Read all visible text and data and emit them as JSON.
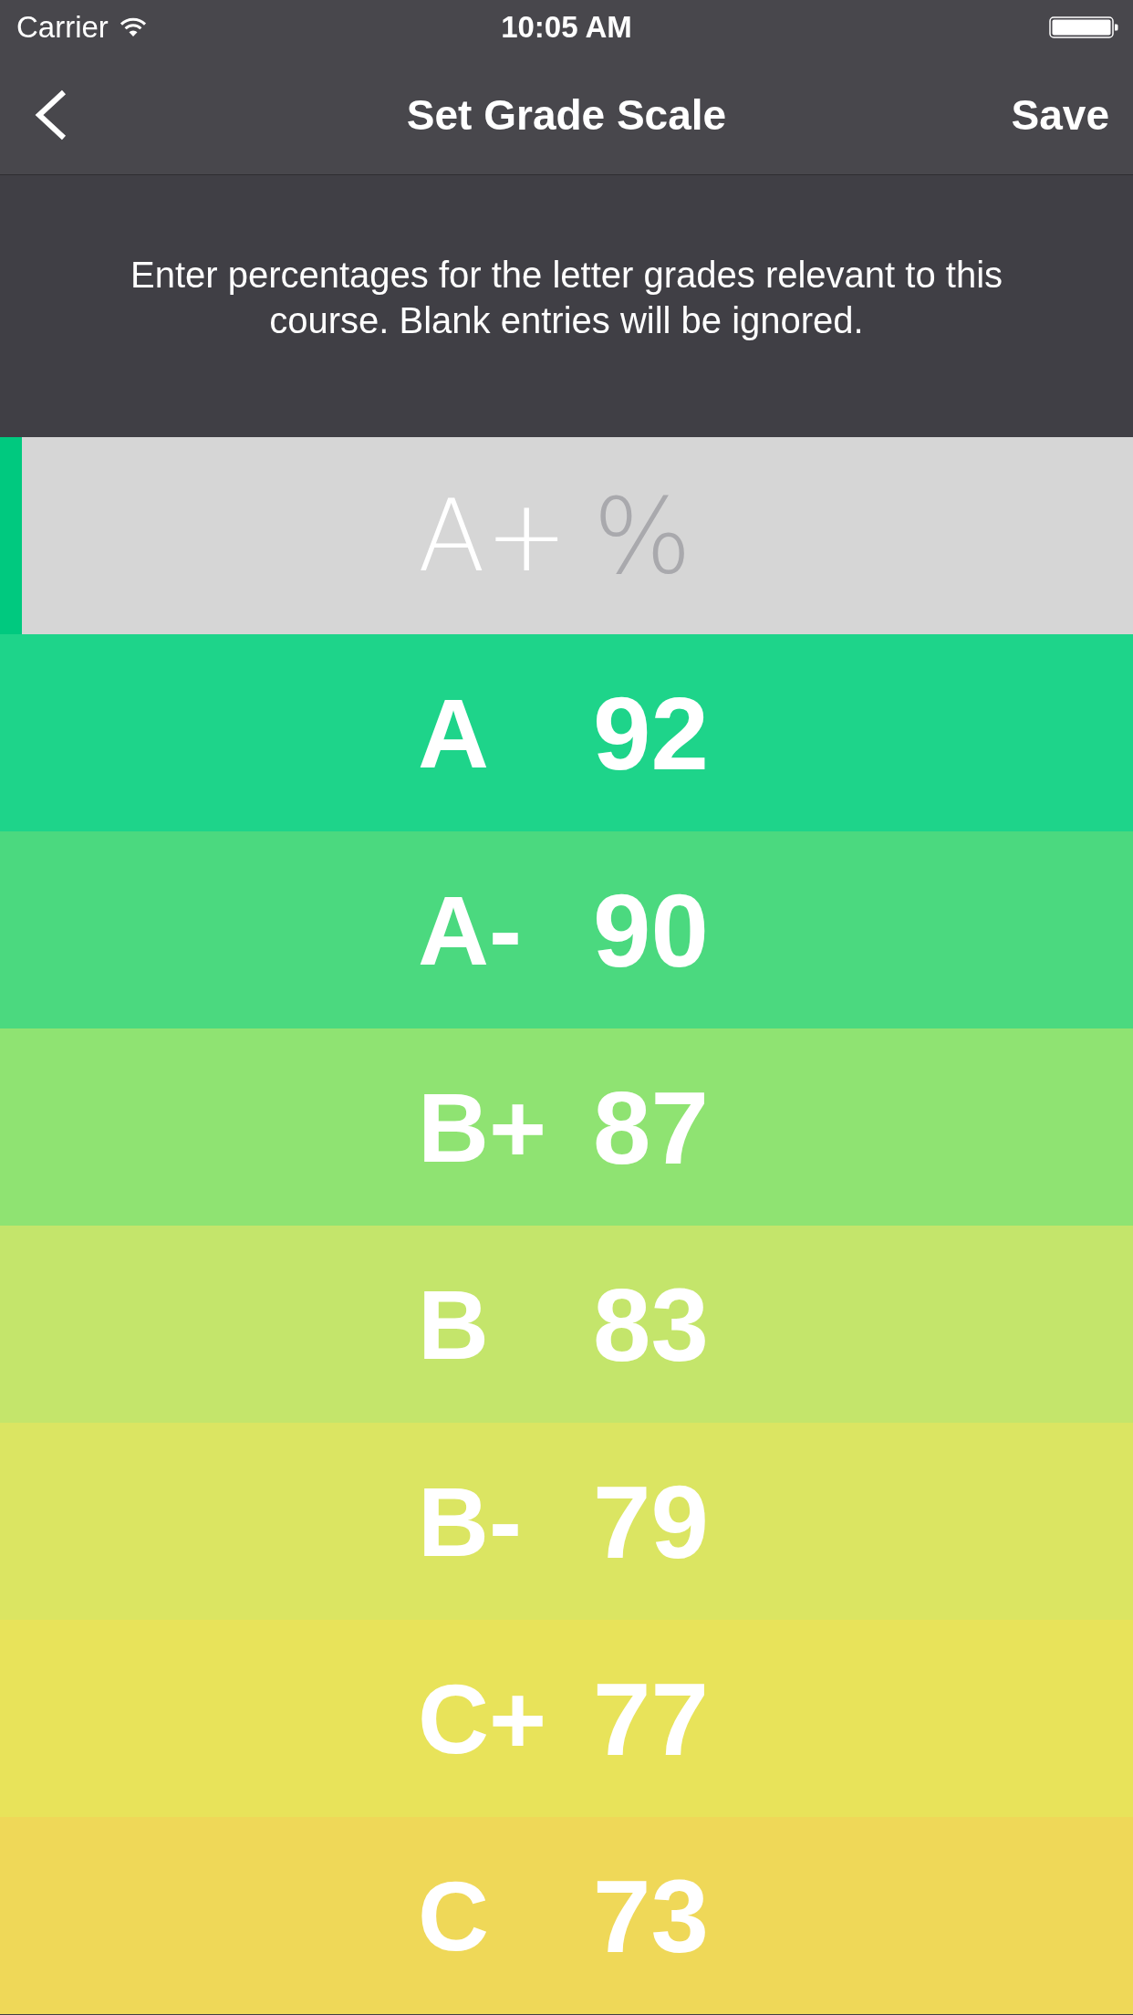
{
  "status_bar": {
    "carrier": "Carrier",
    "time": "10:05 AM"
  },
  "nav_bar": {
    "title": "Set Grade Scale",
    "action": "Save"
  },
  "instructions": "Enter percentages for the letter grades relevant to this course. Blank entries will be ignored.",
  "rows": [
    {
      "grade": "A+",
      "placeholder": "%",
      "selected": true,
      "color": "#00c97f"
    },
    {
      "grade": "A",
      "value": "92",
      "selected": false,
      "color": "#1ed48a"
    },
    {
      "grade": "A-",
      "value": "90",
      "selected": false,
      "color": "#4bd97f"
    },
    {
      "grade": "B+",
      "value": "87",
      "selected": false,
      "color": "#8fe372"
    },
    {
      "grade": "B",
      "value": "83",
      "selected": false,
      "color": "#c4e56b"
    },
    {
      "grade": "B-",
      "value": "79",
      "selected": false,
      "color": "#dbe562"
    },
    {
      "grade": "C+",
      "value": "77",
      "selected": false,
      "color": "#e8e35a"
    },
    {
      "grade": "C",
      "value": "73",
      "selected": false,
      "color": "#efd858"
    }
  ]
}
